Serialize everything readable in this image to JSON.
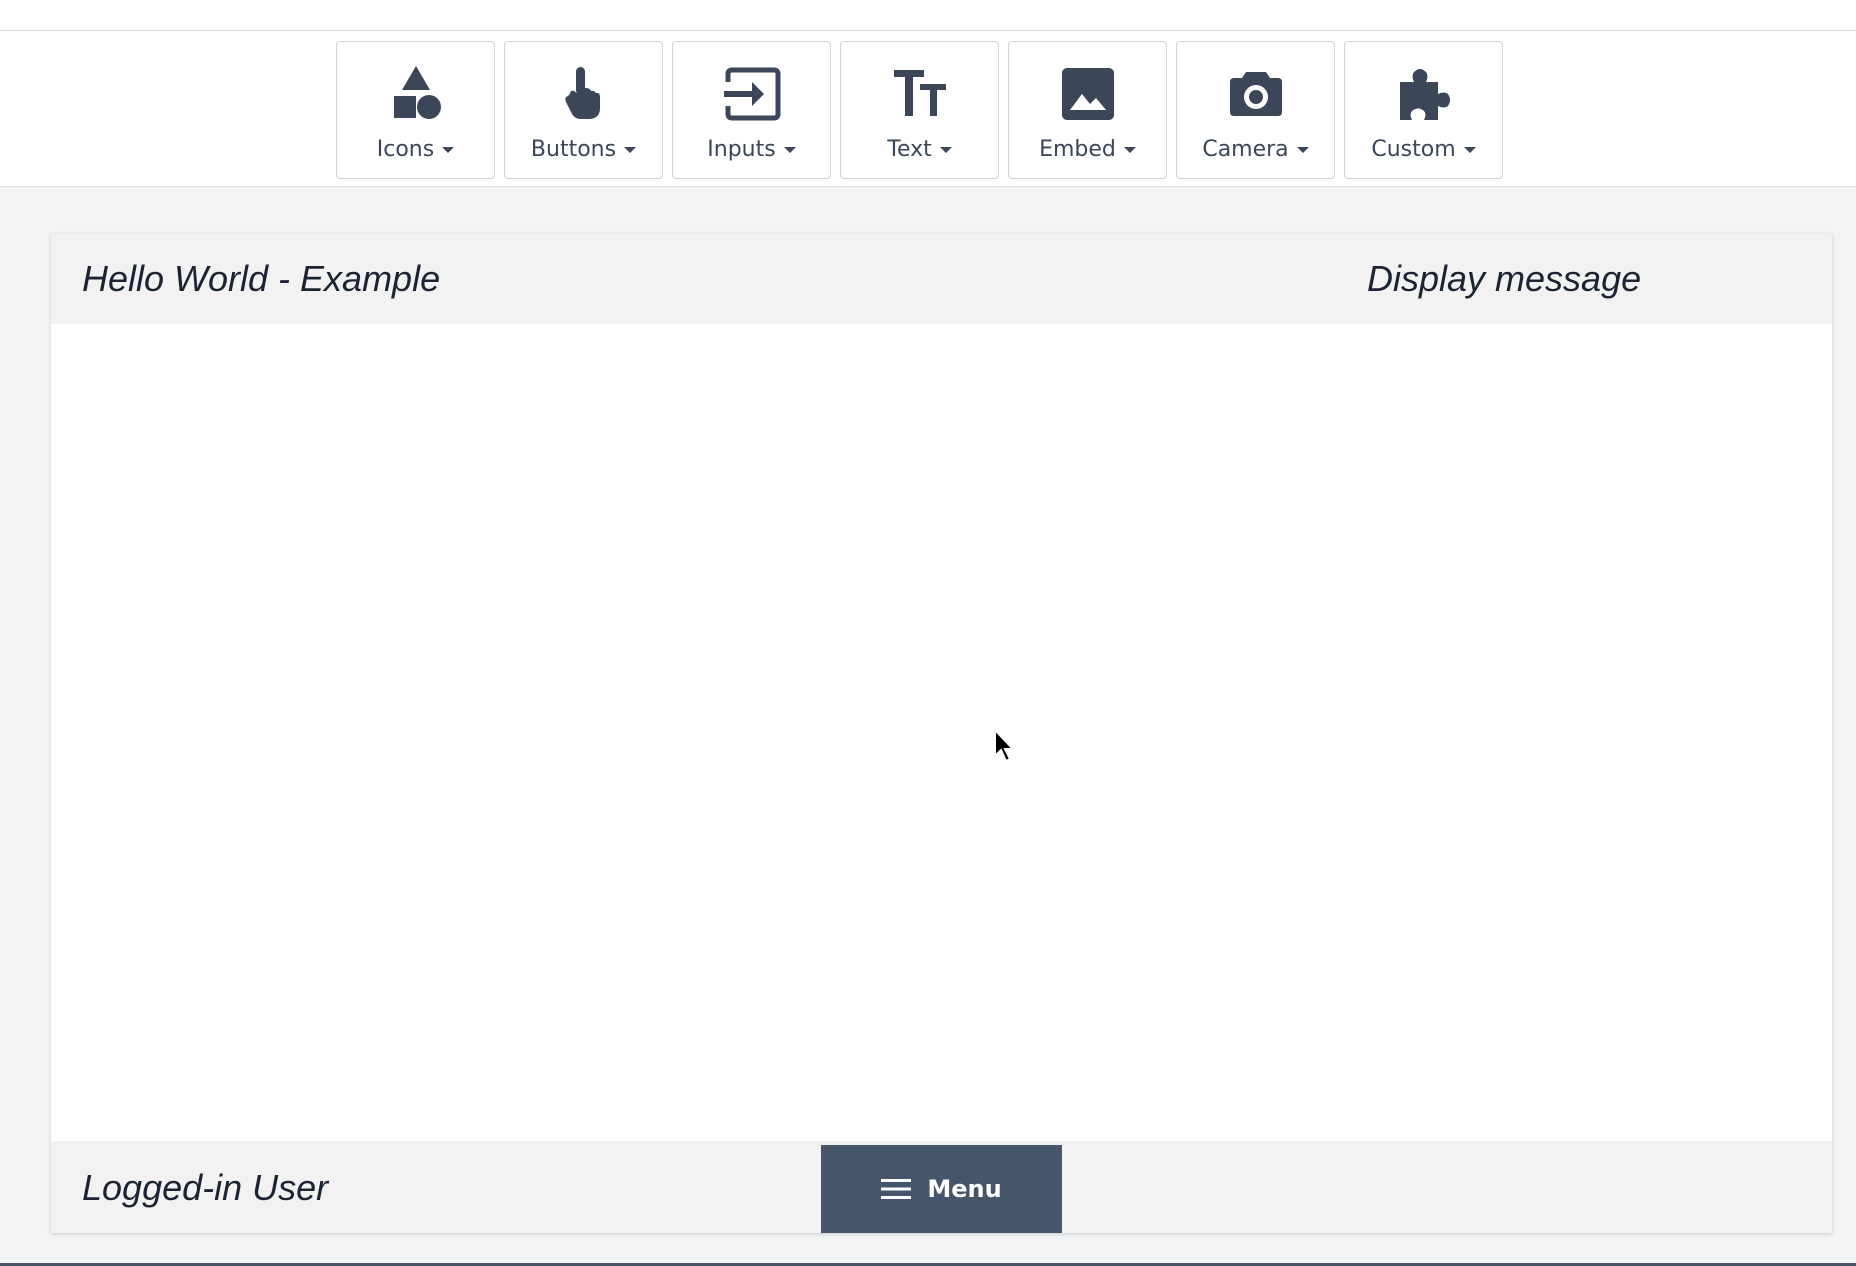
{
  "toolbar": {
    "items": [
      {
        "label": "Icons",
        "icon": "shapes-icon"
      },
      {
        "label": "Buttons",
        "icon": "pointer-hand-icon"
      },
      {
        "label": "Inputs",
        "icon": "input-arrow-icon"
      },
      {
        "label": "Text",
        "icon": "text-size-icon"
      },
      {
        "label": "Embed",
        "icon": "image-icon"
      },
      {
        "label": "Camera",
        "icon": "camera-icon"
      },
      {
        "label": "Custom",
        "icon": "puzzle-icon"
      }
    ]
  },
  "card": {
    "title": "Hello World - Example",
    "message": "Display message",
    "footer_user": "Logged-in User",
    "menu_label": "Menu"
  },
  "colors": {
    "icon": "#3b4758",
    "menu_button": "#46556a",
    "header_bg": "#f2f2f2",
    "page_bg": "#f3f4f6"
  }
}
